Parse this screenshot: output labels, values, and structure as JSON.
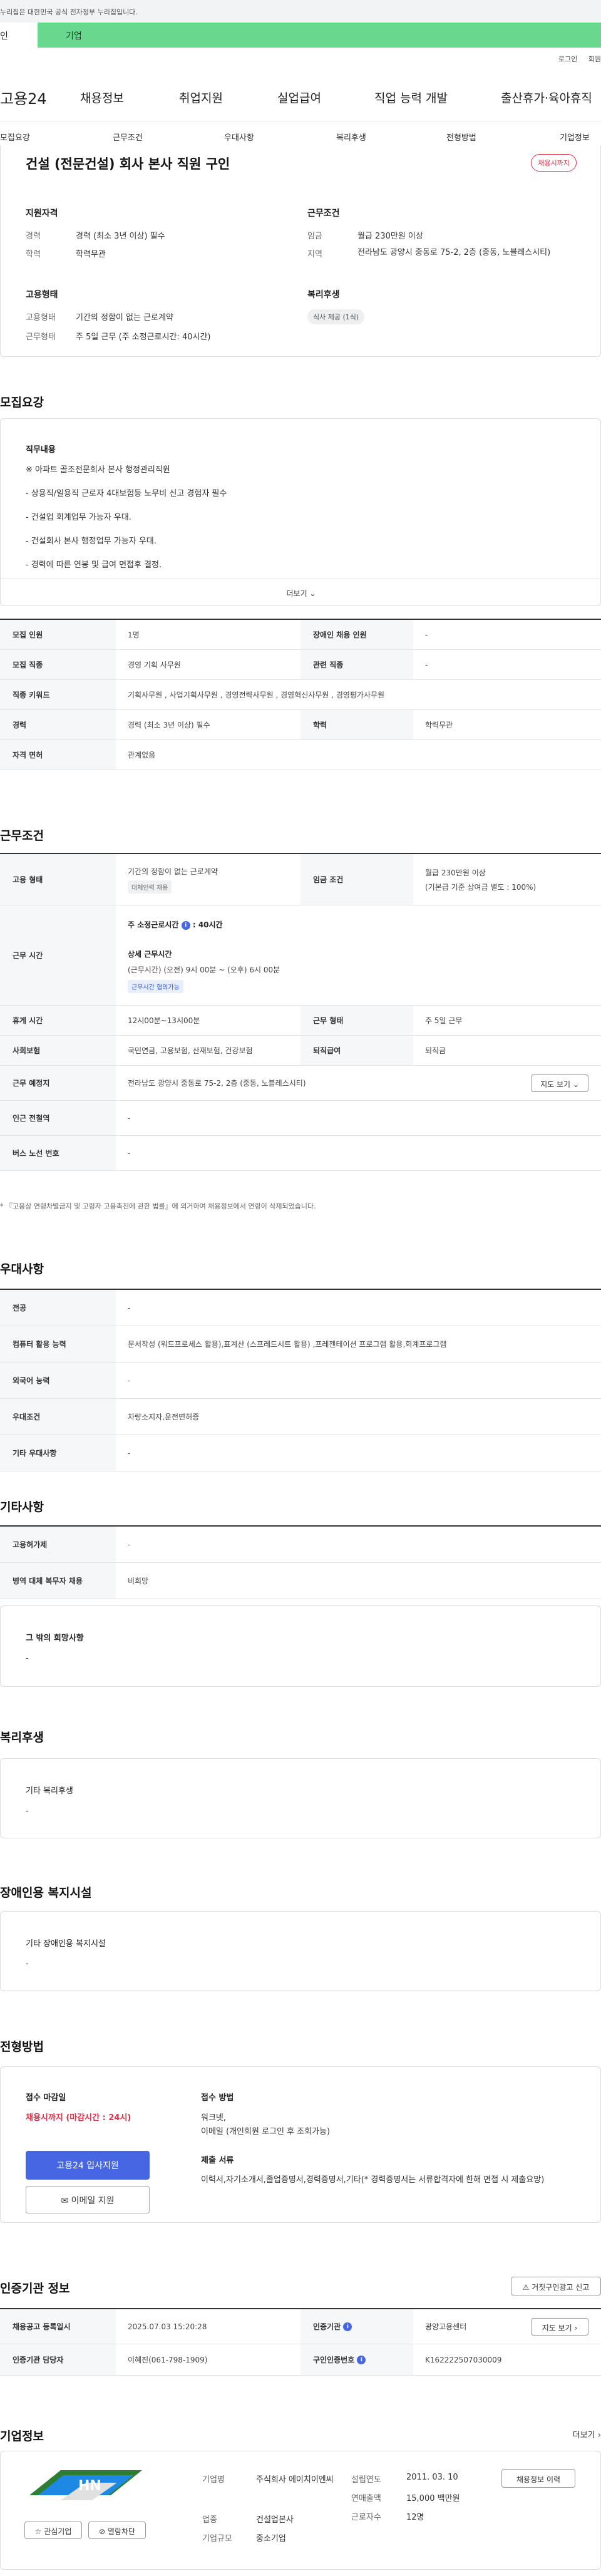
{
  "notice": "누리집은 대한민국 공식 전자정부 누리집입니다.",
  "user_tabs": {
    "personal": "인",
    "company": "기업"
  },
  "utils": {
    "login": "로그인",
    "signup": "회원"
  },
  "gnb": {
    "logo": "고용24",
    "items": [
      "채용정보",
      "취업지원",
      "실업급여",
      "직업 능력 개발",
      "출산휴가·육아휴직"
    ]
  },
  "lnb": [
    "모집요강",
    "근무조건",
    "우대사항",
    "복리후생",
    "전형방법",
    "기업정보"
  ],
  "summary": {
    "title": "건설 (전문건설) 회사 본사 직원 구인",
    "status_badge": "채용시까지",
    "qualification": {
      "heading": "지원자격",
      "career_label": "경력",
      "career_value": "경력 (최소 3년 이상) 필수",
      "edu_label": "학력",
      "edu_value": "학력무관"
    },
    "conditions": {
      "heading": "근무조건",
      "wage_label": "임금",
      "wage_value": "월급 230만원 이상",
      "region_label": "지역",
      "region_value": "전라남도 광양시 중동로 75-2, 2층 (중동, 노블레스시티)"
    },
    "employ": {
      "heading": "고용형태",
      "type_label": "고용형태",
      "type_value": "기간의 정함이 없는 근로계약",
      "hours_label": "근무형태",
      "hours_value": "주 5일 근무 (주 소정근로시간: 40시간)"
    },
    "welfare": {
      "heading": "복리후생",
      "tag": "식사 제공 (1식)"
    }
  },
  "recruit": {
    "section_title": "모집요강",
    "duty_heading": "직무내용",
    "duty_lines": [
      "※ 아파트 골조전문회사 본사 행정관리직원",
      "- 상용직/일용직 근로자 4대보험등 노무비 신고 경험자 필수",
      "- 건설업 회계업무 가능자 우대.",
      "- 건설회사 본사 행정업무 가능자 우대.",
      "- 경력에 따른 연봉 및 급여 면접후 결정."
    ],
    "more_label": "더보기",
    "rows": [
      {
        "k1": "모집 인원",
        "v1": "1명",
        "k2": "장애인 채용 인원",
        "v2": "-"
      },
      {
        "k1": "모집 직종",
        "v1": "경영 기획 사무원",
        "k2": "관련 직종",
        "v2": "-"
      },
      {
        "k1": "직종 키워드",
        "v1": "기획사무원 , 사업기획사무원 , 경영전략사무원 , 경영혁신사무원 , 경영평가사무원"
      },
      {
        "k1": "경력",
        "v1": "경력 (최소 3년 이상) 필수",
        "k2": "학력",
        "v2": "학력무관"
      },
      {
        "k1": "자격 면허",
        "v1": "관계없음"
      }
    ]
  },
  "work": {
    "section_title": "근무조건",
    "employ_label": "고용 형태",
    "employ_value": "기간의 정함이 없는 근로계약",
    "employ_tag": "대체인력 채용",
    "wage_label": "임금 조건",
    "wage_value": "월급 230만원 이상",
    "wage_note": "(기본급 기준 상여금 별도 : 100%)",
    "hours_label": "근무 시간",
    "hours_title": "주 소정근로시간",
    "hours_info": "i",
    "hours_value": ": 40시간",
    "detail_title": "상세 근무시간",
    "detail_value": "(근무시간) (오전) 9시 00분 ~ (오후) 6시 00분",
    "detail_tag": "근무시간 협의가능",
    "rest_label": "휴게 시간",
    "rest_value": "12시00분~13시00분",
    "form_label": "근무 형태",
    "form_value": "주 5일 근무",
    "insurance_label": "사회보험",
    "insurance_value": "국민연금, 고용보험, 산재보험, 건강보험",
    "retire_label": "퇴직급여",
    "retire_value": "퇴직금",
    "place_label": "근무 예정지",
    "place_value": "전라남도 광양시 중동로 75-2, 2층 (중동, 노블레스시티)",
    "map_button": "지도 보기",
    "subway_label": "인근 전철역",
    "subway_value": "-",
    "bus_label": "버스 노선 번호",
    "bus_value": "-",
    "note": "* 『고용상 연령차별금지 및 고령자 고용촉진에 관한 법률』에 의거하여 채용정보에서 연령이 삭제되었습니다."
  },
  "preference": {
    "section_title": "우대사항",
    "rows": [
      {
        "k": "전공",
        "v": "-"
      },
      {
        "k": "컴퓨터 활용 능력",
        "v": "문서작성 (워드프로세스 활용),표계산 (스프레드시트 활용) ,프레젠테이션 프로그램 활용,회계프로그램"
      },
      {
        "k": "외국어 능력",
        "v": "-"
      },
      {
        "k": "우대조건",
        "v": "차량소지자,운전면허증"
      },
      {
        "k": "기타 우대사항",
        "v": "-"
      }
    ]
  },
  "etc": {
    "section_title": "기타사항",
    "rows": [
      {
        "k": "고용허가제",
        "v": "-"
      },
      {
        "k": "병역 대체 복무자 채용",
        "v": "비희망"
      }
    ],
    "wish_title": "그 밖의 희망사항",
    "wish_value": "-"
  },
  "benefit": {
    "section_title": "복리후생",
    "box_title": "기타 복리후생",
    "box_value": "-"
  },
  "disabled": {
    "section_title": "장애인용 복지시설",
    "box_title": "기타 장애인용 복지시설",
    "box_value": "-"
  },
  "selection": {
    "section_title": "전형방법",
    "deadline_title": "접수 마감일",
    "deadline_value": "채용시까지 (마감시간 : 24시)",
    "apply_button": "고용24 입사지원",
    "email_button": "이메일 지원",
    "method_title": "접수 방법",
    "method_lines": [
      "워크넷,",
      "이메일 (개인회원 로그인 후 조회가능)"
    ],
    "docs_title": "제출 서류",
    "docs_value": "이력서,자기소개서,졸업증명서,경력증명서,기타(* 경력증명서는 서류합격자에 한해 면접 시 제출요망)"
  },
  "cert": {
    "section_title": "인증기관 정보",
    "report_button": "거짓구인광고 신고",
    "reg_label": "채용공고 등록일시",
    "reg_value": "2025.07.03 15:20:28",
    "org_label": "인증기관",
    "org_value": "광양고용센터",
    "map_button": "지도 보기",
    "manager_label": "인증기관 담당자",
    "manager_value": "이혜진(061-798-1909)",
    "jobno_label": "구인인증번호",
    "jobno_value": "K162222507030009"
  },
  "company": {
    "section_title": "기업정보",
    "more": "더보기",
    "interest_button": "관심기업",
    "block_button": "열람차단",
    "name_label": "기업명",
    "name_value": "주식회사 에이치이엔씨",
    "industry_label": "업종",
    "industry_value": "건설업본사",
    "scale_label": "기업규모",
    "scale_value": "중소기업",
    "founded_label": "설립연도",
    "founded_value": "2011. 03. 10",
    "sales_label": "연매출액",
    "sales_value": "15,000 백만원",
    "employees_label": "근로자수",
    "employees_value": "12명",
    "history_button": "채용정보 이력"
  }
}
